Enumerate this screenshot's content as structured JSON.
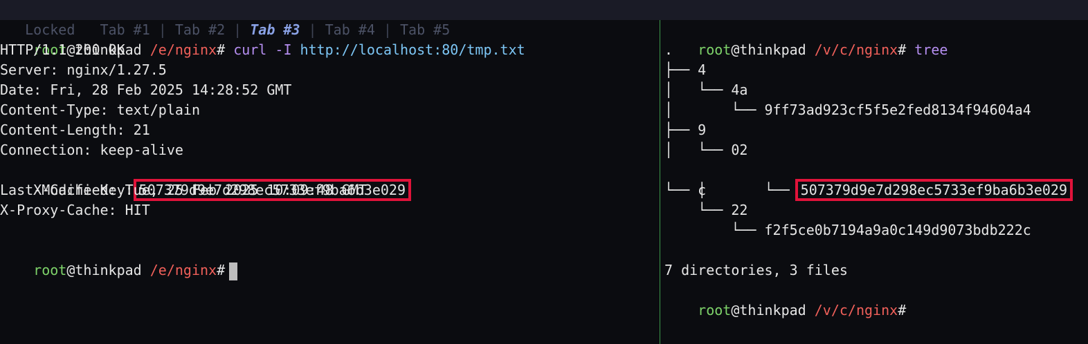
{
  "tabs": {
    "locked": "Locked",
    "items": [
      "Tab #1",
      "Tab #2",
      "Tab #3",
      "Tab #4",
      "Tab #5"
    ],
    "active_index": 2
  },
  "prompt": {
    "user": "root",
    "host": "@thinkpad",
    "left_path": "/e/nginx",
    "right_path": "/v/c/nginx",
    "symbol": "#"
  },
  "left": {
    "command": "curl",
    "flag": "-I",
    "url": "http://localhost:80/tmp.txt",
    "response": [
      "HTTP/1.1 200 OK",
      "Server: nginx/1.27.5",
      "Date: Fri, 28 Feb 2025 14:28:52 GMT",
      "Content-Type: text/plain",
      "Content-Length: 21",
      "Connection: keep-alive"
    ],
    "cache_key_label": "X-Cache-Key:",
    "cache_key_value": "507379d9e7d298ec5733ef9ba6b3e029",
    "after": [
      "Last-Modified: Tue, 25 Feb 2025 10:09:48 GMT",
      "X-Proxy-Cache: HIT"
    ]
  },
  "right": {
    "command": "tree",
    "tree": [
      ".",
      "├── 4",
      "│   └── 4a",
      "│       └── 9ff73ad923cf5f5e2fed8134f94604a4",
      "├── 9",
      "│   └── 02",
      "│       └── ",
      "└── c",
      "    └── 22",
      "        └── f2f5ce0b7194a9a0c149d9073bdb222c"
    ],
    "highlighted_file": "507379d9e7d298ec5733ef9ba6b3e029",
    "summary": "7 directories, 3 files"
  }
}
